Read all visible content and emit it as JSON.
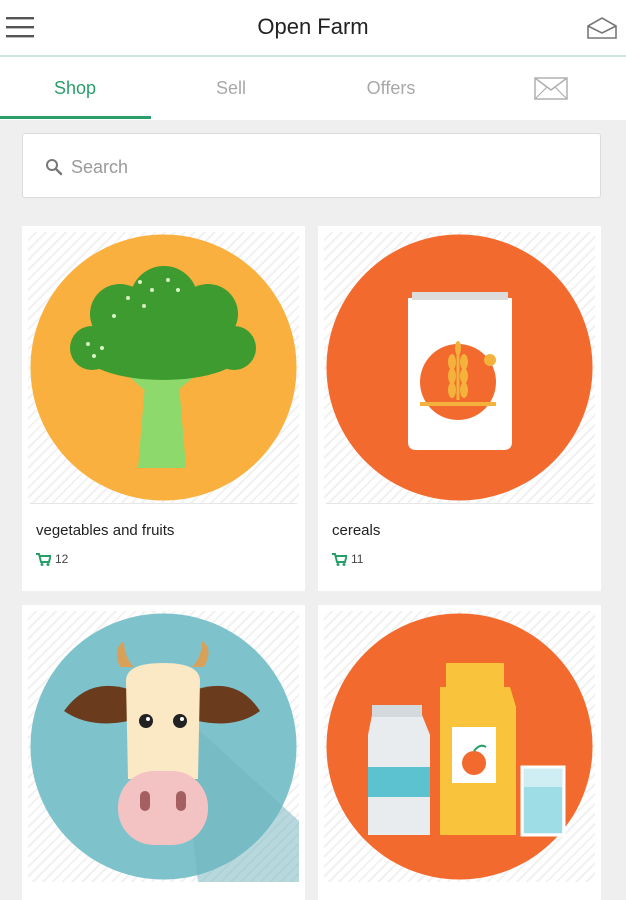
{
  "app": {
    "title": "Open Farm"
  },
  "header": {
    "menu_icon": "hamburger-menu-icon",
    "inbox_icon": "open-envelope-icon"
  },
  "tabs": [
    {
      "label": "Shop",
      "active": true
    },
    {
      "label": "Sell",
      "active": false
    },
    {
      "label": "Offers",
      "active": false
    },
    {
      "icon": "mail-icon",
      "active": false
    }
  ],
  "search": {
    "placeholder": "Search",
    "icon": "search-icon"
  },
  "colors": {
    "accent": "#2a9e6a",
    "orange": "#f26a2e",
    "yellow": "#f9b03f",
    "teal": "#7ec3cc"
  },
  "categories": [
    {
      "title": "vegetables and fruits",
      "count": "12",
      "image": "broccoli-icon"
    },
    {
      "title": "cereals",
      "count": "11",
      "image": "grain-sack-icon"
    },
    {
      "title": "",
      "count": "",
      "image": "cow-icon"
    },
    {
      "title": "",
      "count": "",
      "image": "milk-and-juice-icon"
    }
  ]
}
